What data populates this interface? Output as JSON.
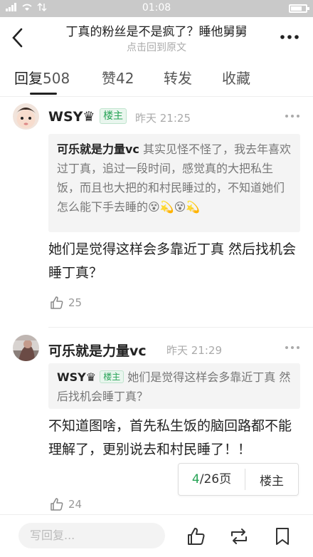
{
  "status_bar": {
    "time": "01:08"
  },
  "header": {
    "title": "丁真的粉丝是不是疯了？睡他舅舅",
    "subtitle": "点击回到原文"
  },
  "tabs": [
    {
      "label": "回复",
      "count": "508"
    },
    {
      "label": "赞",
      "count": "42"
    },
    {
      "label": "转发",
      "count": ""
    },
    {
      "label": "收藏",
      "count": ""
    }
  ],
  "comments": [
    {
      "author": "WSY♛",
      "badge": "楼主",
      "time": "昨天 21:25",
      "quote_author": "可乐就是力量vc",
      "quote_text": " 其实见怪不怪了，我去年喜欢过丁真，追过一段时间，感觉真的大把私生饭，而且也大把的和村民睡过的，不知道她们怎么能下手去睡的😵💫😵💫",
      "body": "她们是觉得这样会多靠近丁真 然后找机会睡丁真？",
      "likes": "25"
    },
    {
      "author": "可乐就是力量vc",
      "time": "昨天 21:29",
      "quote_author": "WSY♛",
      "quote_badge": "楼主",
      "quote_text": " 她们是觉得这样会多靠近丁真 然后找机会睡丁真？",
      "body": "不知道图啥，首先私生饭的脑回路都不能理解了，更别说去和村民睡了！！",
      "likes": "24"
    }
  ],
  "pager": {
    "current": "4",
    "total": "/26页",
    "owner_label": "楼主"
  },
  "bottom_bar": {
    "reply_placeholder": "写回复..."
  },
  "colors": {
    "accent": "#27a356",
    "muted": "#aaaaaa"
  }
}
